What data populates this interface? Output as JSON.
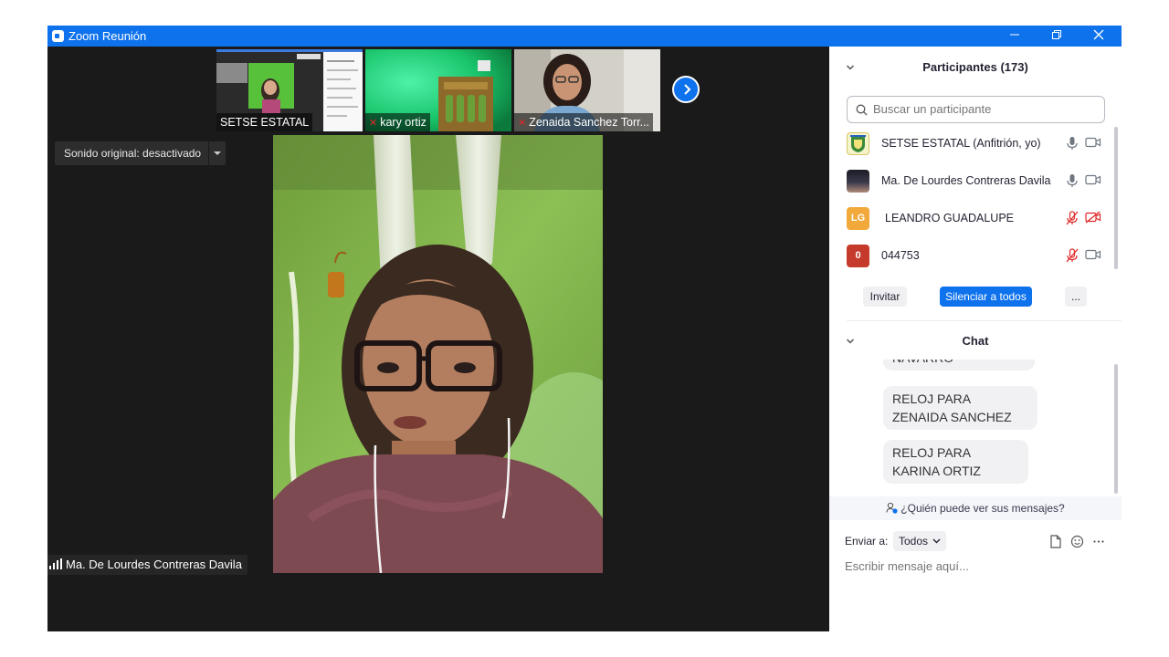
{
  "window": {
    "title": "Zoom Reunión"
  },
  "thumbnails": [
    {
      "name": "SETSE ESTATAL",
      "muted": false
    },
    {
      "name": "kary ortiz",
      "muted": true
    },
    {
      "name": "Zenaida Sanchez Torr...",
      "muted": true
    }
  ],
  "video": {
    "sound_option": "Sonido original: desactivado",
    "active_speaker": "Ma. De Lourdes Contreras Davila"
  },
  "participants": {
    "title": "Participantes (173)",
    "search_placeholder": "Buscar un participante",
    "list": [
      {
        "avatar": "",
        "name": "SETSE ESTATAL (Anfitrión, yo)",
        "mic_muted": false,
        "video_off": false,
        "avatar_color": "#f4f4c8"
      },
      {
        "avatar": "",
        "name": "Ma. De Lourdes Contreras Davila",
        "mic_muted": false,
        "video_off": false,
        "avatar_color": "#2b2b33"
      },
      {
        "avatar": "LG",
        "name": "LEANDRO GUADALUPE",
        "mic_muted": true,
        "video_off": true,
        "avatar_color": "#f2a93b"
      },
      {
        "avatar": "0",
        "name": "044753",
        "mic_muted": true,
        "video_off": false,
        "avatar_color": "#c63a2c"
      }
    ],
    "invite_label": "Invitar",
    "mute_all_label": "Silenciar a todos",
    "more_label": "..."
  },
  "chat": {
    "title": "Chat",
    "messages": [
      "NAVARRO",
      "RELOJ PARA ZENAIDA SANCHEZ",
      "RELOJ PARA KARINA ORTIZ"
    ],
    "who_can_see": "¿Quién puede ver sus mensajes?",
    "send_to_label": "Enviar a:",
    "recipient": "Todos",
    "input_placeholder": "Escribir mensaje aquí..."
  },
  "colors": {
    "accent": "#0e72ed",
    "muted_red": "#e02828",
    "video_bg": "#1a1a1a"
  }
}
